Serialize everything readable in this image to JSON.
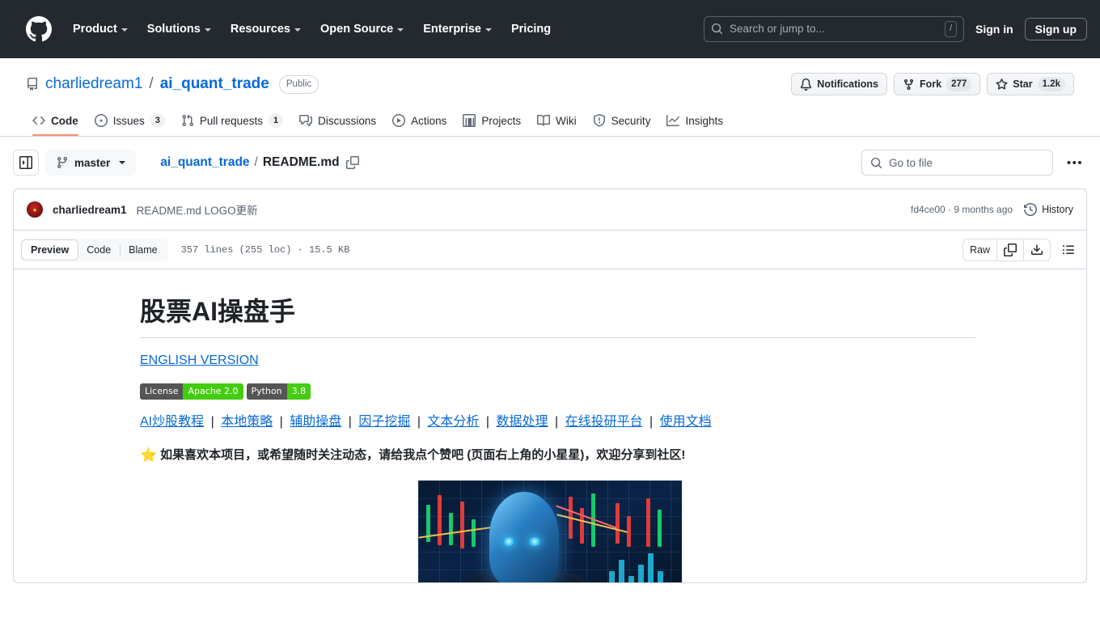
{
  "header": {
    "logo_icon": "github-mark-icon",
    "nav": [
      {
        "label": "Product",
        "has_caret": true
      },
      {
        "label": "Solutions",
        "has_caret": true
      },
      {
        "label": "Resources",
        "has_caret": true
      },
      {
        "label": "Open Source",
        "has_caret": true
      },
      {
        "label": "Enterprise",
        "has_caret": true
      },
      {
        "label": "Pricing",
        "has_caret": false
      }
    ],
    "search": {
      "placeholder": "Search or jump to...",
      "shortcut": "/",
      "icon": "search-icon"
    },
    "sign_in": "Sign in",
    "sign_up": "Sign up",
    "background_color": "#24292f"
  },
  "repo": {
    "icon": "repo-icon",
    "owner": "charliedream1",
    "separator": "/",
    "name": "ai_quant_trade",
    "visibility": "Public",
    "actions": {
      "notifications": {
        "label": "Notifications",
        "icon": "bell-icon"
      },
      "fork": {
        "label": "Fork",
        "count": "277",
        "icon": "fork-icon"
      },
      "star": {
        "label": "Star",
        "count": "1.2k",
        "icon": "star-icon"
      }
    }
  },
  "tabs": [
    {
      "label": "Code",
      "icon": "code-icon",
      "active": true
    },
    {
      "label": "Issues",
      "icon": "issue-opened-icon",
      "count": "3",
      "active": false
    },
    {
      "label": "Pull requests",
      "icon": "git-pull-request-icon",
      "count": "1",
      "active": false
    },
    {
      "label": "Discussions",
      "icon": "comment-discussion-icon",
      "active": false
    },
    {
      "label": "Actions",
      "icon": "play-icon",
      "active": false
    },
    {
      "label": "Projects",
      "icon": "table-icon",
      "active": false
    },
    {
      "label": "Wiki",
      "icon": "book-icon",
      "active": false
    },
    {
      "label": "Security",
      "icon": "shield-icon",
      "active": false
    },
    {
      "label": "Insights",
      "icon": "graph-icon",
      "active": false
    }
  ],
  "filebar": {
    "sidebar_toggle_icon": "sidebar-expand-icon",
    "branch": "master",
    "branch_icon": "git-branch-icon",
    "breadcrumb_repo": "ai_quant_trade",
    "breadcrumb_sep": "/",
    "breadcrumb_file": "README.md",
    "copy_path_icon": "copy-icon",
    "goto_file_placeholder": "Go to file",
    "goto_file_icon": "search-icon",
    "more_options": "•••"
  },
  "commit": {
    "avatar": "author-avatar",
    "author": "charliedream1",
    "message": "README.md LOGO更新",
    "sha": "fd4ce00",
    "meta_separator": "·",
    "relative_time": "9 months ago",
    "meta": "fd4ce00 · 9 months ago",
    "history_label": "History",
    "history_icon": "history-icon"
  },
  "readme_toolbar": {
    "views": [
      {
        "label": "Preview",
        "active": true
      },
      {
        "label": "Code",
        "active": false
      },
      {
        "label": "Blame",
        "active": false
      }
    ],
    "file_stats": "357 lines (255 loc) · 15.5 KB",
    "raw_label": "Raw",
    "copy_icon": "copy-raw-icon",
    "download_icon": "download-icon",
    "outline_icon": "outline-list-icon"
  },
  "readme": {
    "title": "股票AI操盘手",
    "english_version_link": "ENGLISH VERSION",
    "badges": [
      {
        "label": "License",
        "value": "Apache 2.0",
        "label_color": "#555555",
        "value_color": "#44cc11"
      },
      {
        "label": "Python",
        "value": "3.8",
        "label_color": "#555555",
        "value_color": "#44cc11"
      }
    ],
    "nav_links": [
      "AI炒股教程",
      "本地策略",
      "辅助操盘",
      "因子挖掘",
      "文本分析",
      "数据处理",
      "在线投研平台",
      "使用文档"
    ],
    "link_separator": "|",
    "star_icon": "⭐",
    "star_text": "如果喜欢本项目，或希望随时关注动态，请给我点个赞吧 (页面右上角的小星星)，欢迎分享到社区!",
    "logo_image_alt": "ai-quant-trade-logo"
  },
  "colors": {
    "link": "#0969da",
    "accent_underline": "#fd8c73",
    "border": "#d0d7de",
    "muted_text": "#59636e"
  }
}
